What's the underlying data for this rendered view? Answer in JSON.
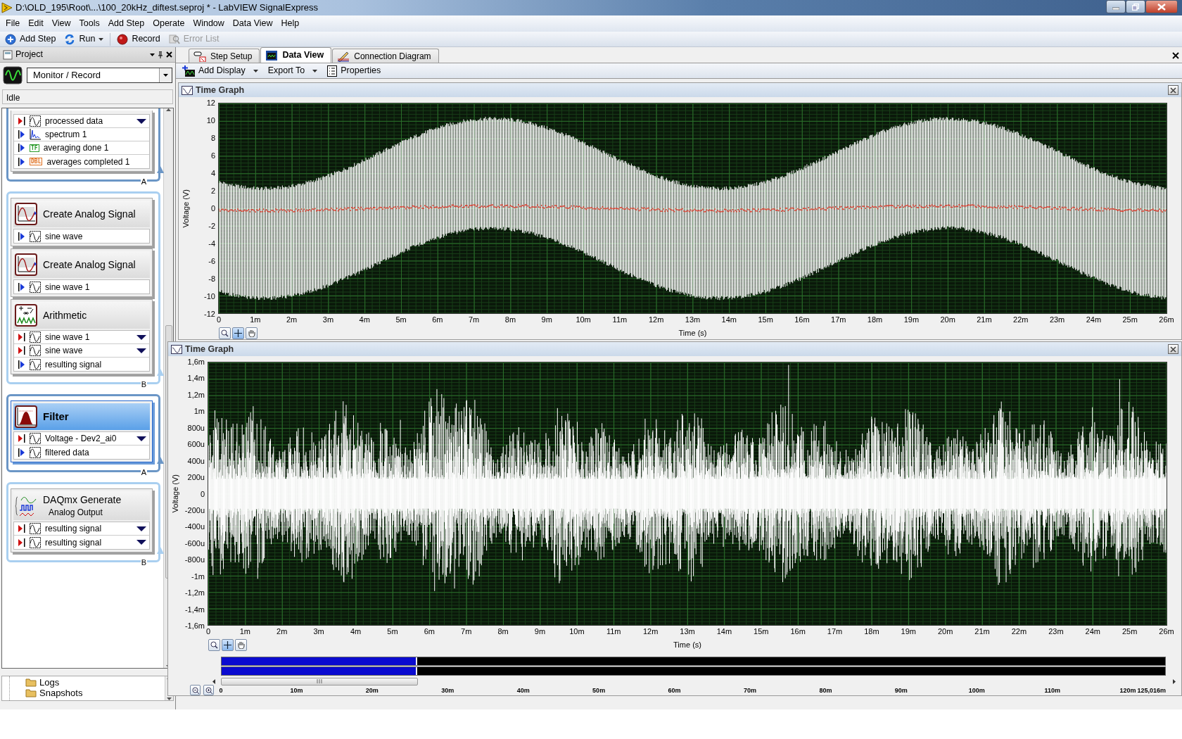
{
  "window": {
    "title": "D:\\OLD_195\\Root\\...\\100_20kHz_diftest.seproj * - LabVIEW SignalExpress"
  },
  "menu": [
    "File",
    "Edit",
    "View",
    "Tools",
    "Add Step",
    "Operate",
    "Window",
    "Data View",
    "Help"
  ],
  "toolbar": [
    {
      "label": "Add Step",
      "kind": "add",
      "dropdown": false,
      "disabled": false
    },
    {
      "label": "Run",
      "kind": "run",
      "dropdown": true,
      "disabled": false
    },
    {
      "label": "Record",
      "kind": "record",
      "dropdown": false,
      "disabled": false
    },
    {
      "label": "Error List",
      "kind": "errors",
      "dropdown": false,
      "disabled": true
    }
  ],
  "project": {
    "title": "Project",
    "mode": "Monitor / Record",
    "status": "Idle",
    "groups": [
      {
        "label": "A",
        "color": "#6b96c6",
        "cut": true,
        "steps": [
          {
            "selected": false,
            "signals": [
              {
                "name": "processed data",
                "input": true,
                "kind": "waveform"
              },
              {
                "name": "spectrum 1",
                "input": false,
                "kind": "spectrum"
              },
              {
                "name": "averaging done 1",
                "input": false,
                "kind": "tag",
                "tag": "TF",
                "color": "#2a9a2a"
              },
              {
                "name": "averages completed 1",
                "input": false,
                "kind": "tag",
                "tag": "DBL",
                "color": "#e07020"
              }
            ]
          }
        ]
      },
      {
        "label": "B",
        "color": "#a9cff0",
        "cut": false,
        "steps": [
          {
            "title": "Create Analog Signal",
            "kind": "signal",
            "selected": false,
            "signals": [
              {
                "name": "sine wave",
                "input": false,
                "kind": "waveform"
              }
            ]
          },
          {
            "title": "Create Analog Signal",
            "kind": "signal",
            "selected": false,
            "signals": [
              {
                "name": "sine wave 1",
                "input": false,
                "kind": "waveform"
              }
            ]
          },
          {
            "title": "Arithmetic",
            "kind": "arithmetic",
            "selected": false,
            "signals": [
              {
                "name": "sine wave 1",
                "input": true,
                "kind": "waveform"
              },
              {
                "name": "sine wave",
                "input": true,
                "kind": "waveform"
              },
              {
                "name": "resulting signal",
                "input": false,
                "kind": "waveform"
              }
            ]
          }
        ]
      },
      {
        "label": "A",
        "color": "#6b96c6",
        "cut": false,
        "steps": [
          {
            "title": "Filter",
            "kind": "filter",
            "selected": true,
            "signals": [
              {
                "name": "Voltage - Dev2_ai0",
                "input": true,
                "kind": "waveform"
              },
              {
                "name": "filtered data",
                "input": false,
                "kind": "waveform"
              }
            ]
          }
        ]
      },
      {
        "label": "B",
        "color": "#a9cff0",
        "cut": false,
        "steps": [
          {
            "title": "DAQmx Generate",
            "subtitle": "Analog Output",
            "kind": "generate",
            "selected": false,
            "signals": [
              {
                "name": "resulting signal",
                "input": true,
                "kind": "waveform"
              },
              {
                "name": "resulting signal",
                "input": true,
                "kind": "waveform"
              }
            ]
          }
        ]
      }
    ],
    "tree": [
      "Logs",
      "Snapshots"
    ]
  },
  "tabs": [
    {
      "label": "Step Setup",
      "kind": "setup",
      "selected": false
    },
    {
      "label": "Data View",
      "kind": "monitor",
      "selected": true
    },
    {
      "label": "Connection Diagram",
      "kind": "diagram",
      "selected": false
    }
  ],
  "data_toolbar": [
    {
      "label": "Add Display",
      "kind": "add-display",
      "dropdown": true
    },
    {
      "label": "Export To",
      "kind": "plain",
      "dropdown": true
    },
    {
      "label": "Properties",
      "kind": "properties",
      "dropdown": false
    }
  ],
  "graphs": [
    {
      "title": "Time Graph",
      "kind": "modulated",
      "ylabel": "Voltage (V)",
      "xlabel": "Time (s)",
      "yticks": [
        "12",
        "10",
        "8",
        "6",
        "4",
        "2",
        "0",
        "-2",
        "-4",
        "-6",
        "-8",
        "-10",
        "-12"
      ],
      "xticks": [
        "0",
        "1m",
        "2m",
        "3m",
        "4m",
        "5m",
        "6m",
        "7m",
        "8m",
        "9m",
        "10m",
        "11m",
        "12m",
        "13m",
        "14m",
        "15m",
        "16m",
        "17m",
        "18m",
        "19m",
        "20m",
        "21m",
        "22m",
        "23m",
        "24m",
        "25m",
        "26m"
      ]
    },
    {
      "title": "Time Graph",
      "kind": "noise",
      "ylabel": "Voltage (V)",
      "xlabel": "Time (s)",
      "yticks": [
        "1,6m",
        "1,4m",
        "1,2m",
        "1m",
        "800u",
        "600u",
        "400u",
        "200u",
        "0",
        "-200u",
        "-400u",
        "-600u",
        "-800u",
        "-1m",
        "-1,2m",
        "-1,4m",
        "-1,6m"
      ],
      "xticks": [
        "0",
        "1m",
        "2m",
        "3m",
        "4m",
        "5m",
        "6m",
        "7m",
        "8m",
        "9m",
        "10m",
        "11m",
        "12m",
        "13m",
        "14m",
        "15m",
        "16m",
        "17m",
        "18m",
        "19m",
        "20m",
        "21m",
        "22m",
        "23m",
        "24m",
        "25m",
        "26m"
      ],
      "timeline": {
        "level": 0.207,
        "ticks": [
          "0",
          "10m",
          "20m",
          "30m",
          "40m",
          "50m",
          "60m",
          "70m",
          "80m",
          "90m",
          "100m",
          "110m",
          "120m",
          "125,016m"
        ]
      }
    }
  ]
}
